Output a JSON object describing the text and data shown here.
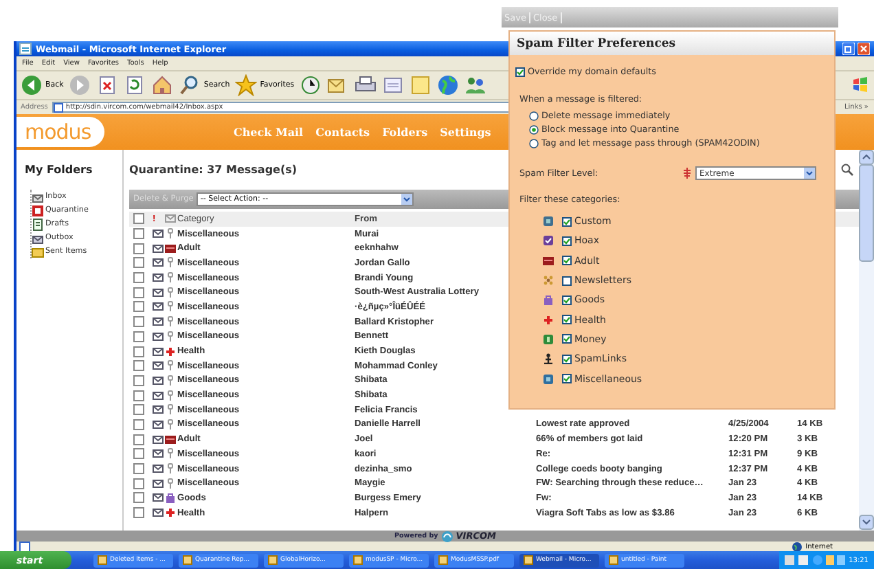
{
  "browser": {
    "title": "Webmail - Microsoft Internet Explorer",
    "menu": [
      "File",
      "Edit",
      "View",
      "Favorites",
      "Tools",
      "Help"
    ],
    "toolbar": [
      {
        "kind": "back",
        "label": "Back"
      },
      {
        "kind": "forward"
      },
      {
        "kind": "stop"
      },
      {
        "kind": "refresh"
      },
      {
        "kind": "home"
      },
      {
        "kind": "search",
        "label": "Search"
      },
      {
        "kind": "favorites",
        "label": "Favorites"
      },
      {
        "kind": "history"
      },
      {
        "kind": "mail"
      },
      {
        "kind": "print"
      },
      {
        "kind": "edit"
      },
      {
        "kind": "note"
      },
      {
        "kind": "globe"
      },
      {
        "kind": "messenger"
      }
    ],
    "address_label": "Address",
    "address": "http://sdin.vircom.com/webmail42/Inbox.aspx",
    "links": "Links »"
  },
  "app": {
    "logo": "modus",
    "nav": [
      "Check Mail",
      "Contacts",
      "Folders",
      "Settings"
    ],
    "sidebar": {
      "title": "My Folders",
      "folders": [
        {
          "label": "Inbox",
          "kind": "inbox"
        },
        {
          "label": "Quarantine",
          "kind": "quarantine"
        },
        {
          "label": "Drafts",
          "kind": "drafts"
        },
        {
          "label": "Outbox",
          "kind": "outbox"
        },
        {
          "label": "Sent Items",
          "kind": "sent"
        }
      ]
    },
    "mailbox": {
      "heading": "Quarantine: 37 Message(s)",
      "action_button": "Delete & Purge",
      "action_select": "-- Select Action: --",
      "columns": [
        "!",
        "Category",
        "From"
      ],
      "select_all_checked": false,
      "rows": [
        {
          "checked": false,
          "kind": "misc",
          "category": "Miscellaneous",
          "from": "Murai"
        },
        {
          "checked": false,
          "kind": "adult",
          "category": "Adult",
          "from": "eeknhahw"
        },
        {
          "checked": false,
          "kind": "misc",
          "category": "Miscellaneous",
          "from": "Jordan Gallo"
        },
        {
          "checked": false,
          "kind": "misc",
          "category": "Miscellaneous",
          "from": "Brandi Young"
        },
        {
          "checked": false,
          "kind": "misc",
          "category": "Miscellaneous",
          "from": "South-West Australia Lottery"
        },
        {
          "checked": false,
          "kind": "misc",
          "category": "Miscellaneous",
          "from": "·è¿ñµç»°ÎüÉÛÉÉ"
        },
        {
          "checked": false,
          "kind": "misc",
          "category": "Miscellaneous",
          "from": "Ballard Kristopher"
        },
        {
          "checked": false,
          "kind": "misc",
          "category": "Miscellaneous",
          "from": "Bennett"
        },
        {
          "checked": false,
          "kind": "health",
          "category": "Health",
          "from": "Kieth Douglas"
        },
        {
          "checked": false,
          "kind": "misc",
          "category": "Miscellaneous",
          "from": "Mohammad Conley"
        },
        {
          "checked": false,
          "kind": "misc",
          "category": "Miscellaneous",
          "from": "Shibata"
        },
        {
          "checked": false,
          "kind": "misc",
          "category": "Miscellaneous",
          "from": "Shibata"
        },
        {
          "checked": false,
          "kind": "misc",
          "category": "Miscellaneous",
          "from": "Felicia Francis"
        },
        {
          "checked": false,
          "kind": "misc",
          "category": "Miscellaneous",
          "from": "Danielle Harrell",
          "column_4": "Lowest rate approved",
          "column_5": "4/25/2004",
          "column_6": "14 KB"
        },
        {
          "checked": false,
          "kind": "adult",
          "category": "Adult",
          "from": "Joel",
          "column_4": "66% of members got laid",
          "column_5": "12:20 PM",
          "column_6": "3 KB"
        },
        {
          "checked": false,
          "kind": "misc",
          "category": "Miscellaneous",
          "from": "kaori",
          "column_4": "Re:",
          "column_5": "12:31 PM",
          "column_6": "9 KB"
        },
        {
          "checked": false,
          "kind": "misc",
          "category": "Miscellaneous",
          "from": "dezinha_smo",
          "column_4": "College coeds booty banging",
          "column_5": "12:37 PM",
          "column_6": "4 KB"
        },
        {
          "checked": false,
          "kind": "misc",
          "category": "Miscellaneous",
          "from": "Maygie",
          "column_4": "FW: Searching through these reduce…",
          "column_5": "Jan 23",
          "column_6": "4 KB"
        },
        {
          "checked": false,
          "kind": "goods",
          "category": "Goods",
          "from": "Burgess Emery",
          "column_4": "Fw:",
          "column_5": "Jan 23",
          "column_6": "14 KB"
        },
        {
          "checked": false,
          "kind": "health",
          "category": "Health",
          "from": "Halpern",
          "column_4": "Viagra Soft Tabs as low as $3.86",
          "column_5": "Jan 23",
          "column_6": "6 KB"
        }
      ]
    },
    "footer": "Powered by",
    "footer_brand": "VIRCOM"
  },
  "status_bar": {
    "zone": "Internet"
  },
  "taskbar": {
    "start": "start",
    "tasks": [
      {
        "label": "Deleted Items - ...",
        "selected": false
      },
      {
        "label": "Quarantine Rep...",
        "selected": false
      },
      {
        "label": "GlobalHorizo...",
        "selected": false
      },
      {
        "label": "modusSP - Micro...",
        "selected": false
      },
      {
        "label": "ModusMSSP.pdf",
        "selected": false
      },
      {
        "label": "Webmail - Micro...",
        "selected": true
      },
      {
        "label": "untitled - Paint",
        "selected": false
      }
    ],
    "clock": "13:21"
  },
  "dialog": {
    "toolbar": [
      "Save",
      "Close"
    ],
    "title": "Spam Filter Preferences",
    "override": {
      "label": "Override my domain defaults",
      "checked": true
    },
    "action_label": "When a message is filtered:",
    "actions": [
      {
        "label": "Delete message immediately",
        "selected": false
      },
      {
        "label": "Block message into Quarantine",
        "selected": true
      },
      {
        "label": "Tag and let message pass through (SPAM42ODIN)",
        "selected": false
      }
    ],
    "level_label": "Spam Filter Level:",
    "level_value": "Extreme",
    "categories_label": "Filter these categories:",
    "categories": [
      {
        "label": "Custom",
        "kind": "custom",
        "checked": true
      },
      {
        "label": "Hoax",
        "kind": "hoax",
        "checked": true
      },
      {
        "label": "Adult",
        "kind": "adult",
        "checked": true
      },
      {
        "label": "Newsletters",
        "kind": "newsletters",
        "checked": false
      },
      {
        "label": "Goods",
        "kind": "goods",
        "checked": true
      },
      {
        "label": "Health",
        "kind": "health",
        "checked": true
      },
      {
        "label": "Money",
        "kind": "money",
        "checked": true
      },
      {
        "label": "SpamLinks",
        "kind": "spamlinks",
        "checked": true
      },
      {
        "label": "Miscellaneous",
        "kind": "misc_box",
        "checked": true
      }
    ]
  }
}
